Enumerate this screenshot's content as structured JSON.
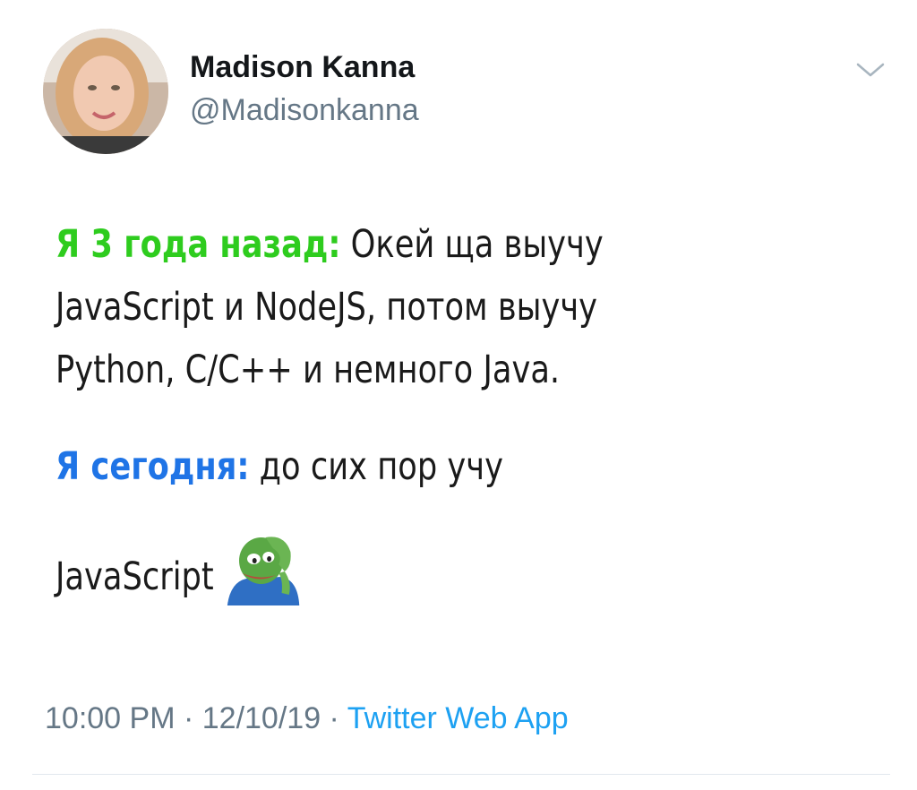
{
  "author": {
    "name": "Madison Kanna",
    "handle": "@Madisonkanna"
  },
  "tweet": {
    "para1_lead": "Я 3 года назад:",
    "para1_line1": " Окей ща выучу",
    "para1_line2": "JavaScript и NodeJS, потом выучу",
    "para1_line3": "Python, C/C++ и немного Java.",
    "para2_lead": "Я сегодня:",
    "para2_text": " до сих пор учу",
    "para3_text": "JavaScript",
    "emoji": "facepalm-pepe-frog-icon"
  },
  "meta": {
    "time": "10:00 PM",
    "separator": " · ",
    "date": "12/10/19",
    "source": "Twitter Web App"
  },
  "colors": {
    "lead_green": "#2ecc1e",
    "lead_blue": "#1f74e6",
    "link_blue": "#1da1f2",
    "muted_gray": "#657786"
  }
}
